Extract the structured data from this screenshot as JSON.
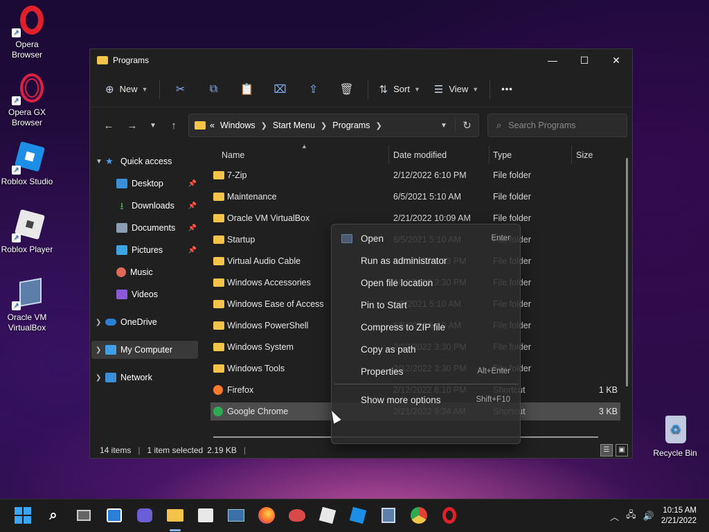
{
  "desktop": {
    "icons": [
      {
        "name": "opera-browser",
        "label": "Opera Browser",
        "line1": "Opera",
        "line2": "Browser"
      },
      {
        "name": "opera-gx-browser",
        "label": "Opera GX Browser",
        "line1": "Opera GX",
        "line2": "Browser"
      },
      {
        "name": "roblox-studio",
        "label": "Roblox Studio",
        "line1": "Roblox Studio",
        "line2": ""
      },
      {
        "name": "roblox-player",
        "label": "Roblox Player",
        "line1": "Roblox Player",
        "line2": ""
      },
      {
        "name": "oracle-vm-virtualbox",
        "label": "Oracle VM VirtualBox",
        "line1": "Oracle VM",
        "line2": "VirtualBox"
      },
      {
        "name": "recycle-bin",
        "label": "Recycle Bin",
        "line1": "Recycle Bin",
        "line2": ""
      }
    ]
  },
  "window": {
    "title": "Programs",
    "minimize": "—",
    "maximize": "☐",
    "close": "✕"
  },
  "toolbar": {
    "new_label": "New",
    "sort_label": "Sort",
    "view_label": "View",
    "more_label": "•••",
    "icons": [
      "cut-icon",
      "copy-icon",
      "paste-icon",
      "rename-icon",
      "share-icon",
      "delete-icon"
    ]
  },
  "address": {
    "overflow": "«",
    "crumbs": [
      "Windows",
      "Start Menu",
      "Programs"
    ],
    "search_placeholder": "Search Programs"
  },
  "nav": {
    "quick_access": "Quick access",
    "items": [
      {
        "label": "Desktop",
        "pinned": true,
        "color": "#3a8fd8"
      },
      {
        "label": "Downloads",
        "pinned": true,
        "color": "#4fb86a"
      },
      {
        "label": "Documents",
        "pinned": true,
        "color": "#8c9db4"
      },
      {
        "label": "Pictures",
        "pinned": true,
        "color": "#3fa5e0"
      },
      {
        "label": "Music",
        "pinned": false,
        "color": "#e06a5a"
      },
      {
        "label": "Videos",
        "pinned": false,
        "color": "#8a5ad8"
      }
    ],
    "onedrive": "OneDrive",
    "my_computer": "My Computer",
    "network": "Network"
  },
  "columns": {
    "name": "Name",
    "date": "Date modified",
    "type": "Type",
    "size": "Size"
  },
  "files": [
    {
      "name": "7-Zip",
      "date": "2/12/2022 6:10 PM",
      "type": "File folder",
      "size": "",
      "kind": "folder"
    },
    {
      "name": "Maintenance",
      "date": "6/5/2021 5:10 AM",
      "type": "File folder",
      "size": "",
      "kind": "folder"
    },
    {
      "name": "Oracle VM VirtualBox",
      "date": "2/21/2022 10:09 AM",
      "type": "File folder",
      "size": "",
      "kind": "folder"
    },
    {
      "name": "Startup",
      "date": "6/5/2021 5:10 AM",
      "type": "File folder",
      "size": "",
      "kind": "folder"
    },
    {
      "name": "Virtual Audio Cable",
      "date": "2/21/2022 8:13 PM",
      "type": "File folder",
      "size": "",
      "kind": "folder"
    },
    {
      "name": "Windows Accessories",
      "date": "2/12/2022 3:30 PM",
      "type": "File folder",
      "size": "",
      "kind": "folder"
    },
    {
      "name": "Windows Ease of Access",
      "date": "6/5/2021 5:10 AM",
      "type": "File folder",
      "size": "",
      "kind": "folder"
    },
    {
      "name": "Windows PowerShell",
      "date": "6/5/2021 5:10 AM",
      "type": "File folder",
      "size": "",
      "kind": "folder"
    },
    {
      "name": "Windows System",
      "date": "2/12/2022 3:30 PM",
      "type": "File folder",
      "size": "",
      "kind": "folder"
    },
    {
      "name": "Windows Tools",
      "date": "2/12/2022 3:30 PM",
      "type": "File folder",
      "size": "",
      "kind": "folder"
    },
    {
      "name": "Firefox",
      "date": "2/12/2022 6:10 PM",
      "type": "Shortcut",
      "size": "1 KB",
      "kind": "shortcut"
    },
    {
      "name": "Google Chrome",
      "date": "2/21/2022 9:34 AM",
      "type": "Shortcut",
      "size": "3 KB",
      "kind": "shortcut"
    }
  ],
  "context_menu": [
    {
      "label": "Open",
      "shortcut": "Enter"
    },
    {
      "label": "Run as administrator",
      "shortcut": ""
    },
    {
      "label": "Open file location",
      "shortcut": ""
    },
    {
      "label": "Pin to Start",
      "shortcut": ""
    },
    {
      "label": "Compress to ZIP file",
      "shortcut": ""
    },
    {
      "label": "Copy as path",
      "shortcut": ""
    },
    {
      "label": "Properties",
      "shortcut": "Alt+Enter"
    },
    {
      "label": "Show more options",
      "shortcut": "Shift+F10"
    }
  ],
  "status": {
    "items": "14 items",
    "selected": "1 item selected",
    "size": "2.19 KB"
  },
  "taskbar": {
    "apps": [
      "start-icon",
      "search-icon",
      "task-view-icon",
      "widgets-icon",
      "chat-icon",
      "file-explorer-icon",
      "store-icon",
      "task-manager-icon",
      "firefox-icon",
      "paint-icon",
      "roblox-player-icon",
      "roblox-studio-icon",
      "virtualbox-icon",
      "chrome-icon",
      "opera-icon"
    ],
    "time": "10:15 AM",
    "date": "2/21/2022"
  },
  "colors": {
    "accent": "#8ab4f8",
    "folder": "#f3c34a",
    "window_bg": "#202020"
  }
}
